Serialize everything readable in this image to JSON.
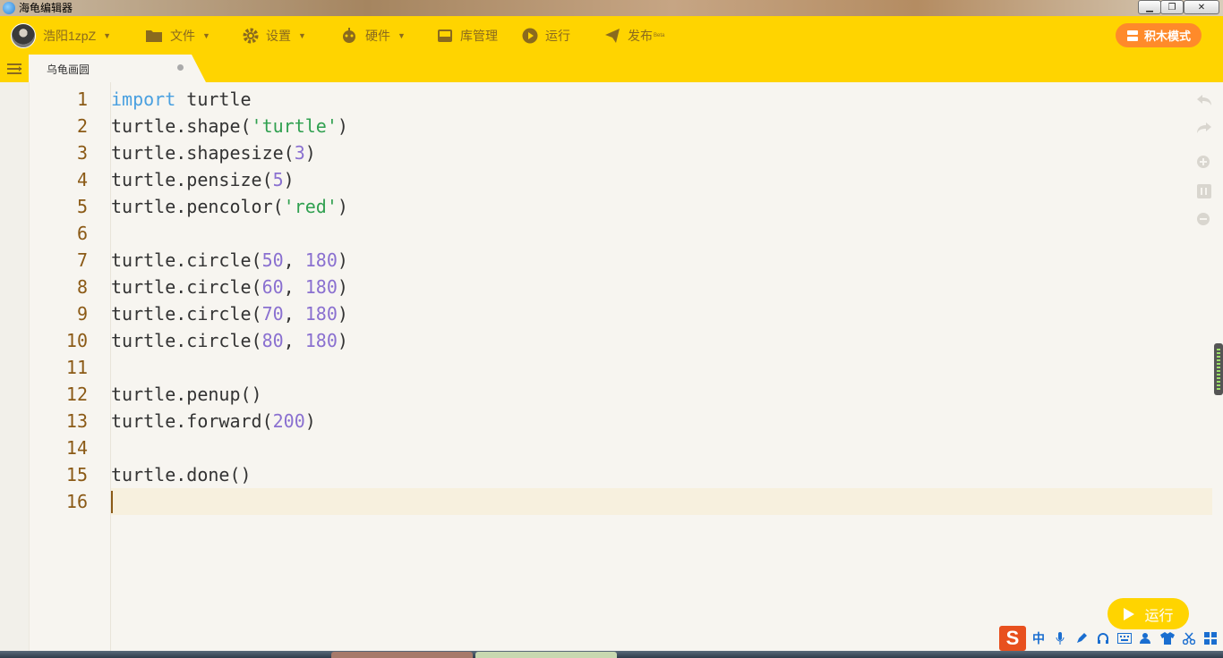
{
  "window": {
    "title": "海龟编辑器",
    "minimize": "▁",
    "maximize": "❐",
    "close": "✕"
  },
  "toolbar": {
    "user_name": "浩阳1zpZ",
    "file_label": "文件",
    "settings_label": "设置",
    "hardware_label": "硬件",
    "library_label": "库管理",
    "run_label": "运行",
    "publish_label": "发布",
    "publish_badge": "Beta",
    "block_mode_label": "积木模式"
  },
  "tab": {
    "name": "乌龟画圆"
  },
  "editor": {
    "lines": [
      {
        "n": "1",
        "tokens": [
          {
            "t": "import",
            "c": "kw"
          },
          {
            "t": " turtle",
            "c": ""
          }
        ]
      },
      {
        "n": "2",
        "tokens": [
          {
            "t": "turtle.shape(",
            "c": ""
          },
          {
            "t": "'turtle'",
            "c": "str"
          },
          {
            "t": ")",
            "c": ""
          }
        ]
      },
      {
        "n": "3",
        "tokens": [
          {
            "t": "turtle.shapesize(",
            "c": ""
          },
          {
            "t": "3",
            "c": "num"
          },
          {
            "t": ")",
            "c": ""
          }
        ]
      },
      {
        "n": "4",
        "tokens": [
          {
            "t": "turtle.pensize(",
            "c": ""
          },
          {
            "t": "5",
            "c": "num"
          },
          {
            "t": ")",
            "c": ""
          }
        ]
      },
      {
        "n": "5",
        "tokens": [
          {
            "t": "turtle.pencolor(",
            "c": ""
          },
          {
            "t": "'red'",
            "c": "str"
          },
          {
            "t": ")",
            "c": ""
          }
        ]
      },
      {
        "n": "6",
        "tokens": []
      },
      {
        "n": "7",
        "tokens": [
          {
            "t": "turtle.circle(",
            "c": ""
          },
          {
            "t": "50",
            "c": "num"
          },
          {
            "t": ", ",
            "c": ""
          },
          {
            "t": "180",
            "c": "num"
          },
          {
            "t": ")",
            "c": ""
          }
        ]
      },
      {
        "n": "8",
        "tokens": [
          {
            "t": "turtle.circle(",
            "c": ""
          },
          {
            "t": "60",
            "c": "num"
          },
          {
            "t": ", ",
            "c": ""
          },
          {
            "t": "180",
            "c": "num"
          },
          {
            "t": ")",
            "c": ""
          }
        ]
      },
      {
        "n": "9",
        "tokens": [
          {
            "t": "turtle.circle(",
            "c": ""
          },
          {
            "t": "70",
            "c": "num"
          },
          {
            "t": ", ",
            "c": ""
          },
          {
            "t": "180",
            "c": "num"
          },
          {
            "t": ")",
            "c": ""
          }
        ]
      },
      {
        "n": "10",
        "tokens": [
          {
            "t": "turtle.circle(",
            "c": ""
          },
          {
            "t": "80",
            "c": "num"
          },
          {
            "t": ", ",
            "c": ""
          },
          {
            "t": "180",
            "c": "num"
          },
          {
            "t": ")",
            "c": ""
          }
        ]
      },
      {
        "n": "11",
        "tokens": []
      },
      {
        "n": "12",
        "tokens": [
          {
            "t": "turtle.penup()",
            "c": ""
          }
        ]
      },
      {
        "n": "13",
        "tokens": [
          {
            "t": "turtle.forward(",
            "c": ""
          },
          {
            "t": "200",
            "c": "num"
          },
          {
            "t": ")",
            "c": ""
          }
        ]
      },
      {
        "n": "14",
        "tokens": []
      },
      {
        "n": "15",
        "tokens": [
          {
            "t": "turtle.done()",
            "c": ""
          }
        ]
      },
      {
        "n": "16",
        "tokens": []
      }
    ]
  },
  "floating_run": {
    "label": "运行"
  },
  "ime": {
    "logo": "S",
    "mode_char": "中",
    "icons": [
      "microphone-icon",
      "pen-icon",
      "headset-icon",
      "keyboard-icon",
      "user-icon",
      "shirt-icon",
      "scissors-icon",
      "grid-icon"
    ]
  },
  "colors": {
    "toolbar": "#ffd400",
    "accent_orange": "#ff8a2a",
    "line_number": "#8b5a16",
    "keyword": "#4aa0e0",
    "string": "#30a050",
    "number": "#8a70d0"
  }
}
